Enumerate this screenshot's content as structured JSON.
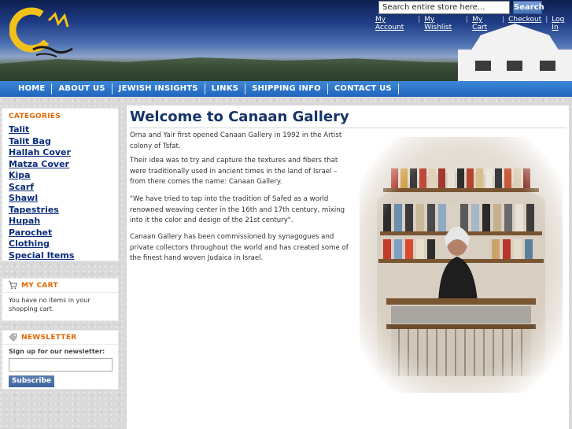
{
  "header": {
    "logo_alt": "Canaan Gallery logo",
    "search": {
      "placeholder": "Search entire store here...",
      "button": "Search"
    },
    "account_links": [
      "My Account",
      "My Wishlist",
      "My Cart",
      "Checkout",
      "Log In"
    ]
  },
  "nav": [
    "HOME",
    "ABOUT US",
    "JEWISH INSIGHTS",
    "LINKS",
    "SHIPPING INFO",
    "CONTACT US"
  ],
  "sidebar": {
    "categories": {
      "title": "CATEGORIES",
      "items": [
        "Talit",
        "Talit Bag",
        "Hallah Cover",
        "Matza Cover",
        "Kipa",
        "Scarf",
        "Shawl",
        "Tapestries",
        "Hupah",
        "Parochet",
        "Clothing",
        "Special Items"
      ]
    },
    "cart": {
      "title": "MY CART",
      "icon": "cart-icon",
      "text": "You have no items in your shopping cart."
    },
    "newsletter": {
      "title": "NEWSLETTER",
      "icon": "tag-icon",
      "label": "Sign up for our newsletter:",
      "button": "Subscribe"
    }
  },
  "main": {
    "title": "Welcome to Canaan Gallery",
    "paragraphs": [
      "Orna and Yair first opened Canaan Gallery in 1992 in the Artist colony of Tsfat.",
      "Their idea was to try and capture the textures and fibers that were traditionally used in ancient times in the land of Israel – from there comes the name: Canaan Gallery.",
      "\"We have tried to tap into the tradition of Safed as a world renowned weaving center in the 16th and 17th century, mixing into it the color and design of the 21st century\".",
      "Canaan Gallery has been commissioned by synagogues and private collectors throughout the world and has created some of the finest hand woven Judaica in Israel."
    ],
    "photo_alt": "Weaver at loom with shelves of yarn spools"
  },
  "colors": {
    "nav": "#2a73c9",
    "accent": "#e26703",
    "link": "#0a2c7a",
    "title": "#163468"
  }
}
